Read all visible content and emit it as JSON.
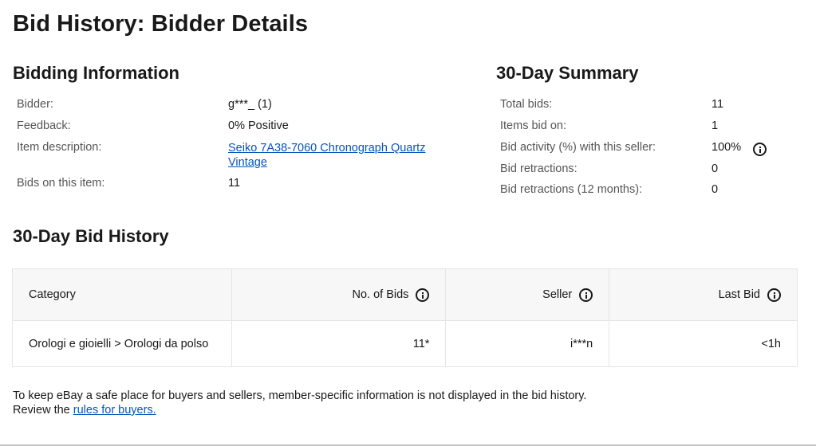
{
  "page": {
    "title": "Bid History: Bidder Details"
  },
  "bidding_info": {
    "heading": "Bidding Information",
    "bidder_label": "Bidder:",
    "bidder_value": "g***_ (1)",
    "feedback_label": "Feedback:",
    "feedback_value": "0% Positive",
    "item_label": "Item description:",
    "item_link_line1": "Seiko 7A38-7060 Chronograph Quartz",
    "item_link_line2": "Vintage",
    "bids_label": "Bids on this item:",
    "bids_value": "11"
  },
  "summary": {
    "heading": "30-Day Summary",
    "total_bids_label": "Total bids:",
    "total_bids_value": "11",
    "items_bid_label": "Items bid on:",
    "items_bid_value": "1",
    "activity_label": "Bid activity (%) with this seller:",
    "activity_value": "100%",
    "retractions_label": "Bid retractions:",
    "retractions_value": "0",
    "retractions12_label": "Bid retractions (12 months):",
    "retractions12_value": "0"
  },
  "history": {
    "heading": "30-Day Bid History",
    "columns": {
      "category": "Category",
      "bids": "No. of Bids",
      "seller": "Seller",
      "last_bid": "Last Bid"
    },
    "rows": [
      {
        "category": "Orologi e gioielli > Orologi da polso",
        "bids": "11*",
        "seller": "i***n",
        "last_bid": "<1h"
      }
    ]
  },
  "footer": {
    "line1": "To keep eBay a safe place for buyers and sellers, member-specific information is not displayed in the bid history.",
    "line2_prefix": "Review the ",
    "line2_link": "rules for buyers."
  }
}
